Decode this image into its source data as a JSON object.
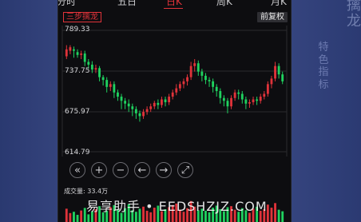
{
  "tabs": [
    {
      "label": "分时",
      "active": false
    },
    {
      "label": "五日",
      "active": false
    },
    {
      "label": "日K",
      "active": true
    },
    {
      "label": "周K",
      "active": false
    },
    {
      "label": "月K",
      "active": false
    }
  ],
  "indicator_badge": "三步擒龙",
  "adjust_button": "前复权",
  "price_axis": {
    "p1": "789.33",
    "p2": "737.75",
    "p3": "675.97",
    "p4": "614.79"
  },
  "controls": [
    "«",
    "+",
    "−",
    "←",
    "→",
    "⤢"
  ],
  "volume_label": "成交量: 33.4万",
  "watermark": "易享助手 • EEDSHZJZ.COM",
  "side": {
    "big": "擒龙",
    "vertical": "特色指标"
  },
  "colors": {
    "up": "#e0333a",
    "down": "#1fd25f",
    "bg": "#0d0d10"
  },
  "chart_data": {
    "type": "candlestick",
    "ylim": [
      614.79,
      789.33
    ],
    "candles": [
      [
        752,
        762,
        748,
        768
      ],
      [
        760,
        765,
        755,
        768
      ],
      [
        762,
        760,
        750,
        766
      ],
      [
        758,
        754,
        750,
        762
      ],
      [
        754,
        756,
        748,
        760
      ],
      [
        756,
        744,
        738,
        760
      ],
      [
        744,
        740,
        734,
        748
      ],
      [
        740,
        733,
        728,
        745
      ],
      [
        733,
        735,
        728,
        740
      ],
      [
        735,
        722,
        716,
        738
      ],
      [
        722,
        718,
        710,
        725
      ],
      [
        718,
        708,
        700,
        722
      ],
      [
        708,
        712,
        702,
        716
      ],
      [
        712,
        700,
        692,
        716
      ],
      [
        700,
        694,
        688,
        704
      ],
      [
        694,
        688,
        676,
        698
      ],
      [
        688,
        684,
        676,
        692
      ],
      [
        684,
        680,
        672,
        690
      ],
      [
        680,
        676,
        666,
        684
      ],
      [
        676,
        670,
        662,
        680
      ],
      [
        670,
        666,
        658,
        674
      ],
      [
        666,
        672,
        662,
        676
      ],
      [
        672,
        676,
        668,
        680
      ],
      [
        676,
        680,
        672,
        684
      ],
      [
        680,
        685,
        676,
        688
      ],
      [
        685,
        682,
        676,
        690
      ],
      [
        682,
        690,
        678,
        694
      ],
      [
        690,
        686,
        680,
        694
      ],
      [
        686,
        694,
        682,
        698
      ],
      [
        694,
        700,
        690,
        704
      ],
      [
        700,
        706,
        696,
        712
      ],
      [
        706,
        712,
        702,
        716
      ],
      [
        712,
        716,
        706,
        720
      ],
      [
        716,
        722,
        710,
        726
      ],
      [
        722,
        738,
        718,
        744
      ],
      [
        738,
        742,
        730,
        748
      ],
      [
        742,
        730,
        724,
        746
      ],
      [
        730,
        724,
        716,
        734
      ],
      [
        724,
        718,
        712,
        728
      ],
      [
        718,
        716,
        708,
        722
      ],
      [
        716,
        708,
        700,
        720
      ],
      [
        708,
        702,
        694,
        712
      ],
      [
        702,
        692,
        684,
        706
      ],
      [
        692,
        688,
        680,
        696
      ],
      [
        688,
        680,
        670,
        692
      ],
      [
        680,
        692,
        676,
        696
      ],
      [
        692,
        700,
        688,
        704
      ],
      [
        700,
        698,
        690,
        704
      ],
      [
        698,
        690,
        684,
        702
      ],
      [
        690,
        684,
        676,
        694
      ],
      [
        684,
        686,
        678,
        690
      ],
      [
        686,
        690,
        682,
        694
      ],
      [
        690,
        688,
        682,
        694
      ],
      [
        688,
        694,
        684,
        698
      ],
      [
        694,
        698,
        690,
        702
      ],
      [
        698,
        712,
        694,
        716
      ],
      [
        712,
        720,
        706,
        724
      ],
      [
        720,
        738,
        716,
        744
      ],
      [
        738,
        726,
        720,
        742
      ],
      [
        726,
        716,
        712,
        730
      ]
    ],
    "volumes": [
      0.52,
      0.35,
      0.4,
      0.28,
      0.45,
      0.55,
      0.3,
      0.42,
      0.5,
      0.62,
      0.38,
      0.44,
      0.58,
      0.66,
      0.48,
      0.36,
      0.54,
      0.7,
      0.46,
      0.4,
      0.52,
      0.6,
      0.44,
      0.38,
      0.56,
      0.64,
      0.42,
      0.5,
      0.58,
      0.66,
      0.72,
      0.48,
      0.4,
      0.54,
      0.82,
      0.6,
      0.46,
      0.52,
      0.44,
      0.38,
      0.56,
      0.64,
      0.5,
      0.42,
      0.58,
      0.62,
      0.48,
      0.4,
      0.54,
      0.46,
      0.36,
      0.52,
      0.6,
      0.44,
      0.5,
      0.68,
      0.56,
      0.74,
      0.48,
      0.42
    ]
  }
}
